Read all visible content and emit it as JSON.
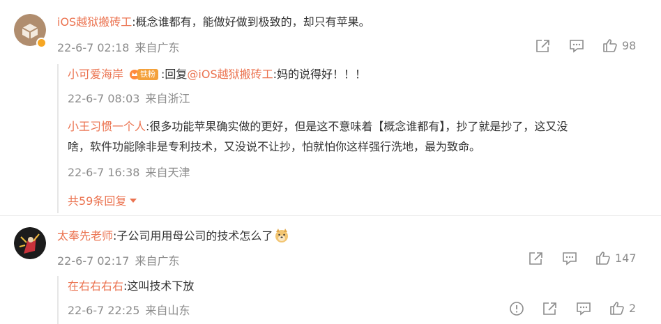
{
  "comments": [
    {
      "author": "iOS越狱搬砖工",
      "text": ":概念谁都有，能做好做到极致的，却只有苹果。",
      "date": "22-6-7 02:18",
      "source": "来自广东",
      "likes": "98",
      "verified_icon": "verified-badge-icon",
      "replies": [
        {
          "author": "小可爱海岸",
          "badge": "铁粉",
          "reply_prefix": ":回复",
          "mention": "@iOS越狱搬砖工",
          "text": ":妈的说得好！！！",
          "date": "22-6-7 08:03",
          "source": "来自浙江"
        },
        {
          "author": "小王习惯一个人",
          "text_line1": ":很多功能苹果确实做的更好，但是这不意味着【概念谁都有】，抄了就是抄了，这又没",
          "text_line2": "啥，软件功能除非是专利技术，又没说不让抄，怕就怕你这样强行洗地，最为致命。",
          "date": "22-6-7 16:38",
          "source": "来自天津"
        }
      ],
      "more_replies": "共59条回复"
    },
    {
      "author": "太奉先老师",
      "text": ":子公司用用母公司的技术怎么了",
      "emoji": "doge-emoji-icon",
      "date": "22-6-7 02:17",
      "source": "来自广东",
      "likes": "147",
      "replies": [
        {
          "author": "在右右右右",
          "text": ":这叫技术下放",
          "date": "22-6-7 22:25",
          "source": "来自山东",
          "likes": "2"
        }
      ]
    }
  ],
  "colors": {
    "name": "#eb7350",
    "meta": "#8c8c8c",
    "text": "#333333",
    "badge": "#f4a13a"
  }
}
